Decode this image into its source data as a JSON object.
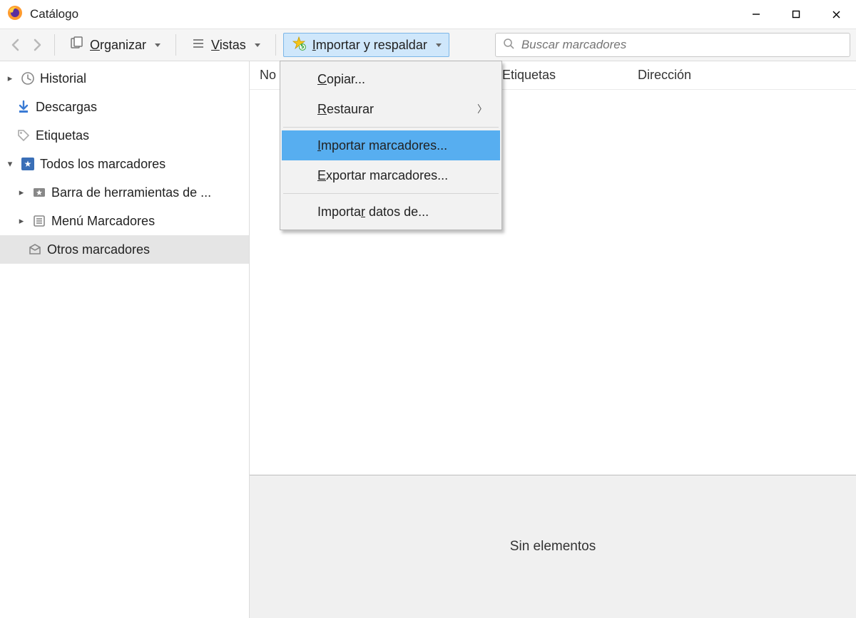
{
  "window": {
    "title": "Catálogo"
  },
  "toolbar": {
    "organize": "Organizar",
    "views": "Vistas",
    "import": "Importar y respaldar"
  },
  "search": {
    "placeholder": "Buscar marcadores"
  },
  "sidebar": {
    "history": "Historial",
    "downloads": "Descargas",
    "tags": "Etiquetas",
    "all_bookmarks": "Todos los marcadores",
    "toolbar_folder": "Barra de herramientas de ...",
    "menu_folder": "Menú Marcadores",
    "other_folder": "Otros marcadores"
  },
  "columns": {
    "name": "Nombre",
    "tags": "Etiquetas",
    "address": "Dirección"
  },
  "columns_short": {
    "name_clipped": "No"
  },
  "menu": {
    "copy": "Copiar...",
    "restore": "Restaurar",
    "import_bm": "Importar marcadores...",
    "export_bm": "Exportar marcadores...",
    "import_data": "Importar datos de..."
  },
  "details": {
    "empty": "Sin elementos"
  }
}
